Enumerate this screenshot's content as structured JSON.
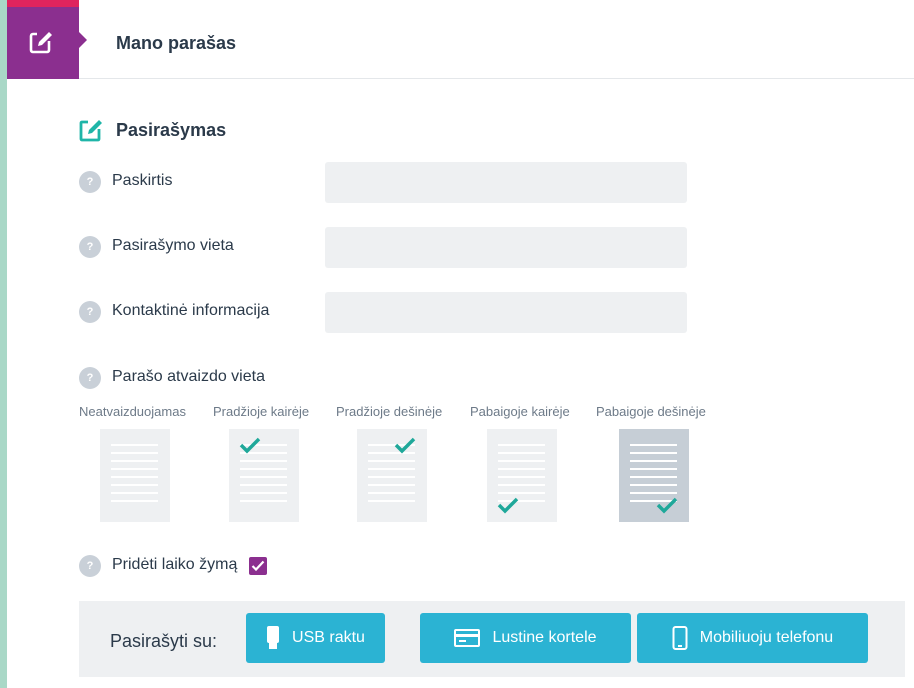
{
  "header": {
    "title": "Mano parašas",
    "icon": "edit-icon",
    "accent_color": "#8b2f8f"
  },
  "section": {
    "title": "Pasirašymas",
    "icon": "edit-icon",
    "icon_color": "#1fb5a8"
  },
  "fields": [
    {
      "label": "Paskirtis",
      "value": "",
      "help": "?"
    },
    {
      "label": "Pasirašymo vieta",
      "value": "",
      "help": "?"
    },
    {
      "label": "Kontaktinė informacija",
      "value": "",
      "help": "?"
    }
  ],
  "placement": {
    "label": "Parašo atvaizdo vieta",
    "help": "?",
    "options": [
      {
        "label": "Neatvaizduojamas",
        "check": "none",
        "selected": false
      },
      {
        "label": "Pradžioje kairėje",
        "check": "top-left",
        "selected": false
      },
      {
        "label": "Pradžioje dešinėje",
        "check": "top-right",
        "selected": false
      },
      {
        "label": "Pabaigoje kairėje",
        "check": "bottom-left",
        "selected": false
      },
      {
        "label": "Pabaigoje dešinėje",
        "check": "bottom-right",
        "selected": true
      }
    ]
  },
  "timestamp": {
    "label": "Pridėti laiko žymą",
    "help": "?",
    "checked": true
  },
  "sign_with": {
    "label": "Pasirašyti su:",
    "buttons": [
      {
        "label": "USB raktu",
        "icon": "usb-key-icon"
      },
      {
        "label": "Lustine kortele",
        "icon": "smart-card-icon"
      },
      {
        "label": "Mobiliuoju telefonu",
        "icon": "mobile-phone-icon"
      }
    ]
  },
  "colors": {
    "primary_button": "#2bb3d3",
    "check": "#1fa89a",
    "brand": "#8b2f8f",
    "brand_accent": "#e0245e"
  }
}
